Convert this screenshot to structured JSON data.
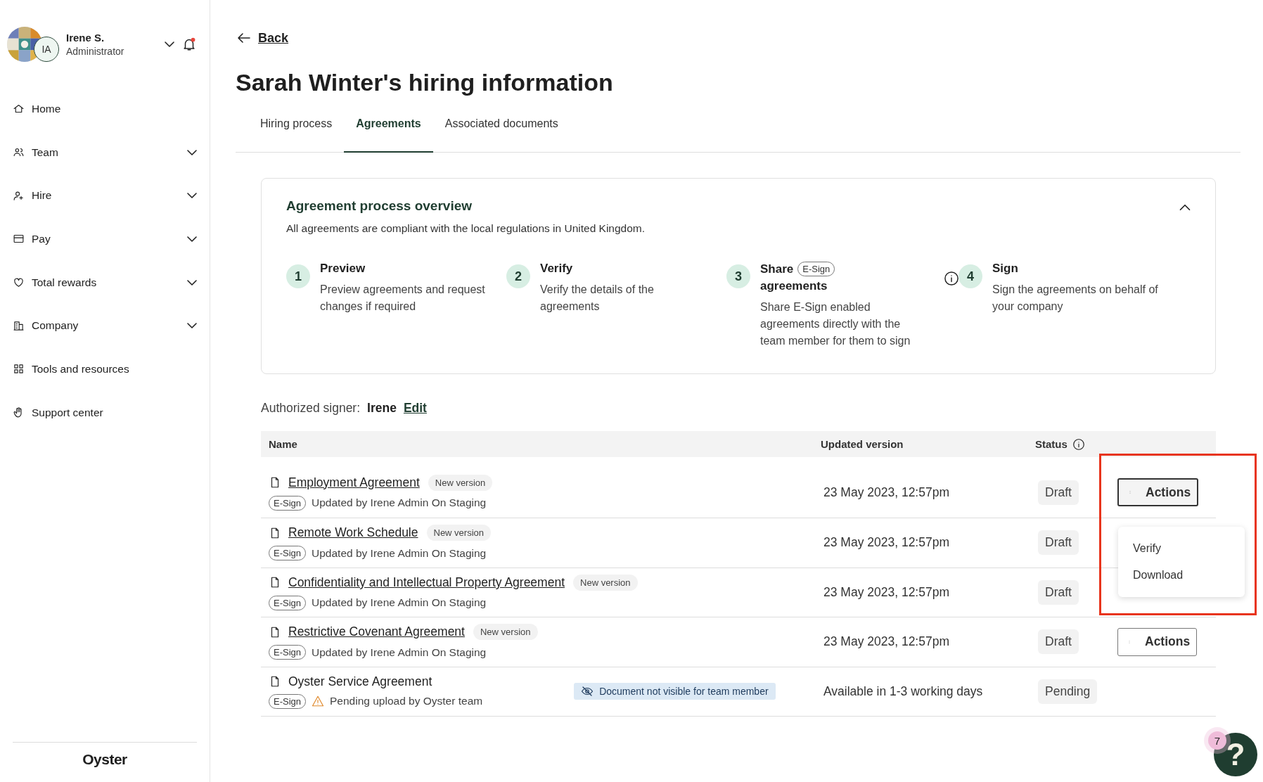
{
  "user": {
    "name": "Irene S.",
    "role": "Administrator",
    "initials": "IA",
    "has_notification": true
  },
  "sidebar": {
    "items": [
      {
        "label": "Home",
        "kind": "home",
        "expandable": false
      },
      {
        "label": "Team",
        "kind": "team",
        "expandable": true
      },
      {
        "label": "Hire",
        "kind": "hire",
        "expandable": true
      },
      {
        "label": "Pay",
        "kind": "pay",
        "expandable": true
      },
      {
        "label": "Total rewards",
        "kind": "rewards",
        "expandable": true
      },
      {
        "label": "Company",
        "kind": "company",
        "expandable": true
      },
      {
        "label": "Tools and resources",
        "kind": "tools",
        "expandable": false
      },
      {
        "label": "Support center",
        "kind": "support",
        "expandable": false
      }
    ],
    "logo": "Oyster"
  },
  "back": "Back",
  "title": "Sarah Winter's hiring information",
  "tabs": [
    {
      "label": "Hiring process",
      "selected": false
    },
    {
      "label": "Agreements",
      "selected": true
    },
    {
      "label": "Associated documents",
      "selected": false
    }
  ],
  "overview": {
    "title": "Agreement process overview",
    "subtitle": "All agreements are compliant with the local regulations in United Kingdom.",
    "expanded": true,
    "steps": [
      {
        "number": "1",
        "title": "Preview",
        "text": "Preview agreements and request changes if required",
        "info": false
      },
      {
        "number": "2",
        "title": "Verify",
        "text": "Verify the details of the agreements",
        "info": false
      },
      {
        "number": "3",
        "title": "Share",
        "badge": "E-Sign",
        "title_line2": "agreements",
        "text": "Share E-Sign enabled agreements directly with the team member for them to sign",
        "info": true
      },
      {
        "number": "4",
        "title": "Sign",
        "text": "Sign the agreements on behalf of your company",
        "info": false
      }
    ]
  },
  "signer": {
    "label": "Authorized signer:",
    "name": "Irene",
    "edit": "Edit"
  },
  "table": {
    "columns": [
      {
        "label": "Name",
        "info": false
      },
      {
        "label": "Updated version",
        "info": false
      },
      {
        "label": "Status",
        "info": true
      }
    ],
    "rows": [
      {
        "name": "Employment Agreement",
        "link": true,
        "tag": "New version",
        "esign": "E-Sign",
        "note": "Updated by Irene Admin On Staging",
        "warning": false,
        "updated": "23 May 2023, 12:57pm",
        "status": "Draft",
        "actions": "Actions",
        "actions_focused": true
      },
      {
        "name": "Remote Work Schedule",
        "link": true,
        "tag": "New version",
        "esign": "E-Sign",
        "note": "Updated by Irene Admin On Staging",
        "warning": false,
        "updated": "23 May 2023, 12:57pm",
        "status": "Draft"
      },
      {
        "name": "Confidentiality and Intellectual Property Agreement",
        "link": true,
        "tag": "New version",
        "esign": "E-Sign",
        "note": "Updated by Irene Admin On Staging",
        "warning": false,
        "updated": "23 May 2023, 12:57pm",
        "status": "Draft"
      },
      {
        "name": "Restrictive Covenant Agreement",
        "link": true,
        "tag": "New version",
        "esign": "E-Sign",
        "note": "Updated by Irene Admin On Staging",
        "warning": false,
        "updated": "23 May 2023, 12:57pm",
        "status": "Draft",
        "actions": "Actions",
        "actions_focused": false
      },
      {
        "name": "Oyster Service Agreement",
        "link": false,
        "esign": "E-Sign",
        "note": "Pending upload by Oyster team",
        "warning": true,
        "visibility": "Document not visible for team member",
        "updated": "Available in 1-3 working days",
        "status": "Pending"
      }
    ]
  },
  "menu": {
    "items": [
      "Verify",
      "Download"
    ]
  },
  "highlight": true,
  "help": {
    "label": "?",
    "count": "7"
  }
}
